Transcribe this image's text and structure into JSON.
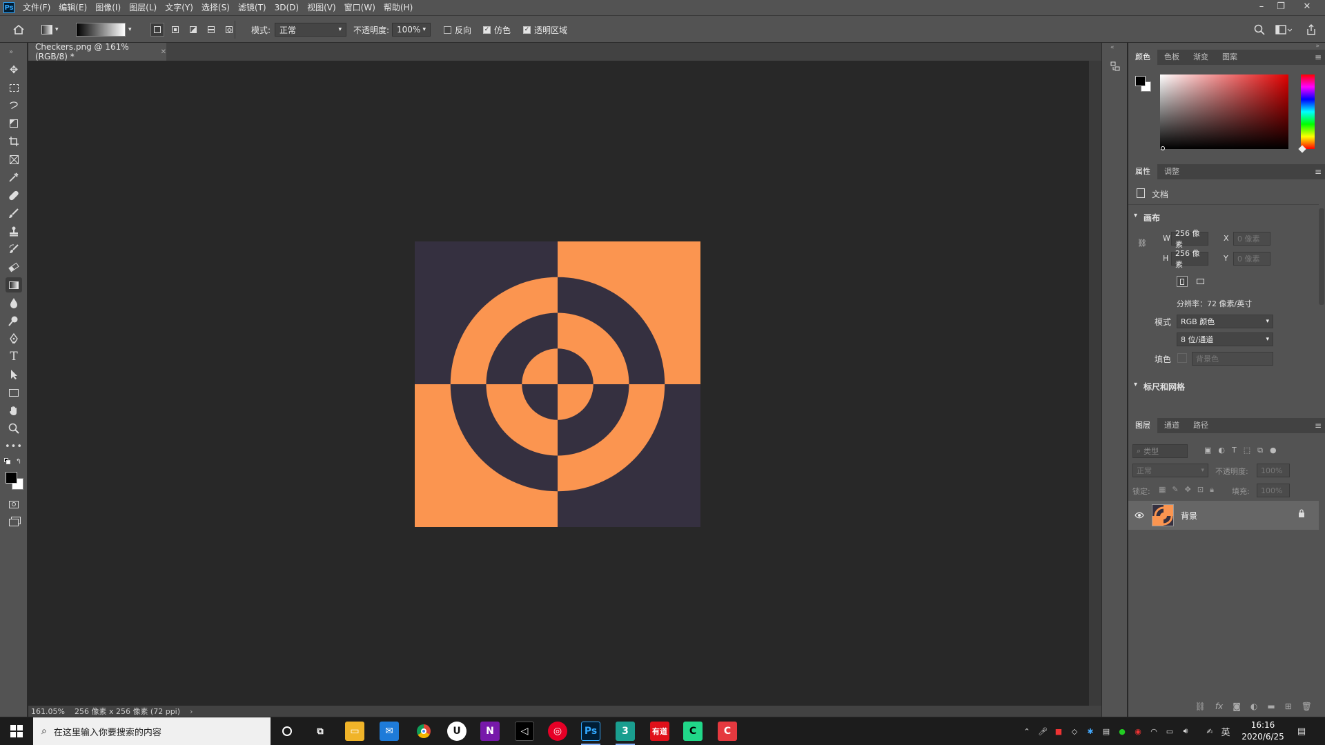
{
  "app": {
    "logo": "Ps",
    "menu": [
      "文件(F)",
      "编辑(E)",
      "图像(I)",
      "图层(L)",
      "文字(Y)",
      "选择(S)",
      "滤镜(T)",
      "3D(D)",
      "视图(V)",
      "窗口(W)",
      "帮助(H)"
    ],
    "window_controls": [
      "minimize-icon",
      "restore-icon",
      "close-icon"
    ]
  },
  "options": {
    "mode_label": "模式:",
    "mode_value": "正常",
    "opacity_label": "不透明度:",
    "opacity_value": "100%",
    "reverse_label": "反向",
    "reverse_checked": false,
    "dither_label": "仿色",
    "dither_checked": true,
    "transparency_label": "透明区域",
    "transparency_checked": true
  },
  "document": {
    "tab_title": "Checkers.png @ 161%(RGB/8) *",
    "zoom": "161.05%",
    "size_info": "256 像素 x 256 像素 (72 ppi)",
    "colors": {
      "dark": "#353040",
      "orange": "#fb9550"
    }
  },
  "color_panel": {
    "tabs": [
      "颜色",
      "色板",
      "渐变",
      "图案"
    ],
    "foreground": "#000000",
    "background": "#ffffff"
  },
  "properties_panel": {
    "tabs": [
      "属性",
      "调整"
    ],
    "doc_label": "文档",
    "canvas_section": "画布",
    "w_label": "W",
    "w_value": "256 像素",
    "h_label": "H",
    "h_value": "256 像素",
    "x_label": "X",
    "x_value": "0 像素",
    "y_label": "Y",
    "y_value": "0 像素",
    "resolution": "分辨率：72 像素/英寸",
    "mode_label": "模式",
    "mode_value": "RGB 颜色",
    "depth_value": "8 位/通道",
    "fill_label": "填色",
    "fill_value": "背景色",
    "rulers_section": "标尺和网格"
  },
  "layers_panel": {
    "tabs": [
      "图层",
      "通道",
      "路径"
    ],
    "filter_placeholder": "类型",
    "blend_mode": "正常",
    "opacity_label": "不透明度:",
    "opacity_value": "100%",
    "lock_label": "锁定:",
    "fill_label": "填充:",
    "fill_value": "100%",
    "layers": [
      {
        "name": "背景",
        "visible": true,
        "locked": true
      }
    ]
  },
  "taskbar": {
    "search_placeholder": "在这里输入你要搜索的内容",
    "time": "16:16",
    "date": "2020/6/25",
    "ime": "英"
  }
}
